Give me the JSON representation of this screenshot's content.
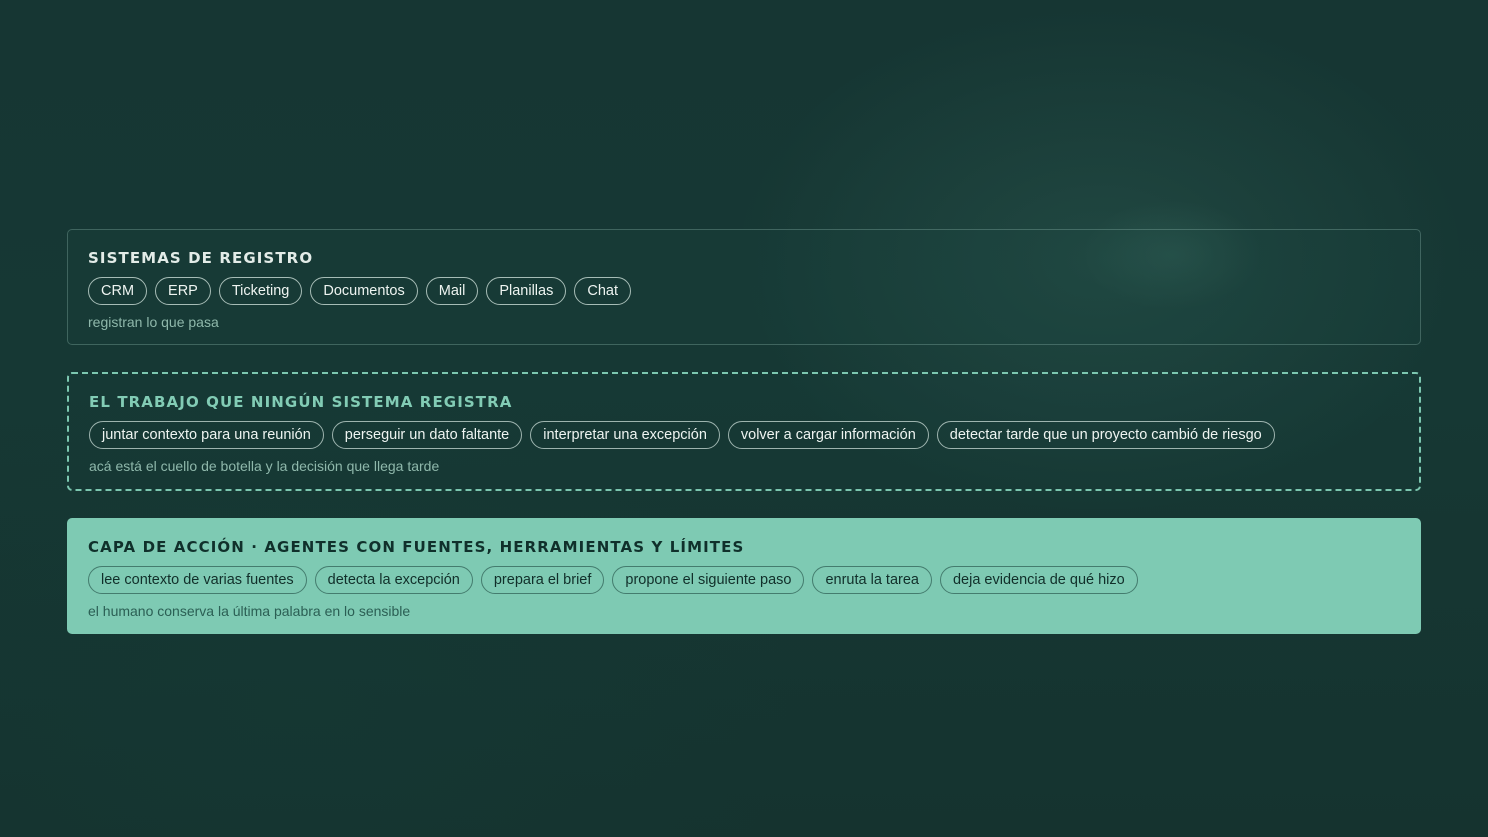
{
  "layers": [
    {
      "title": "SISTEMAS DE REGISTRO",
      "chips": [
        "CRM",
        "ERP",
        "Ticketing",
        "Documentos",
        "Mail",
        "Planillas",
        "Chat"
      ],
      "caption": "registran lo que pasa"
    },
    {
      "title": "EL TRABAJO QUE NINGÚN SISTEMA REGISTRA",
      "chips": [
        "juntar contexto para una reunión",
        "perseguir un dato faltante",
        "interpretar una excepción",
        "volver a cargar información",
        "detectar tarde que un proyecto cambió de riesgo"
      ],
      "caption": "acá está el cuello de botella y la decisión que llega tarde"
    },
    {
      "title": "CAPA DE ACCIÓN · AGENTES CON FUENTES, HERRAMIENTAS Y LÍMITES",
      "chips": [
        "lee contexto de varias fuentes",
        "detecta la excepción",
        "prepara el brief",
        "propone el siguiente paso",
        "enruta la tarea",
        "deja evidencia de qué hizo"
      ],
      "caption": "el humano conserva la última palabra en lo sensible"
    }
  ],
  "colors": {
    "background": "#163633",
    "accent": "#7ecab3",
    "dashed_border": "#7cc7b0"
  }
}
